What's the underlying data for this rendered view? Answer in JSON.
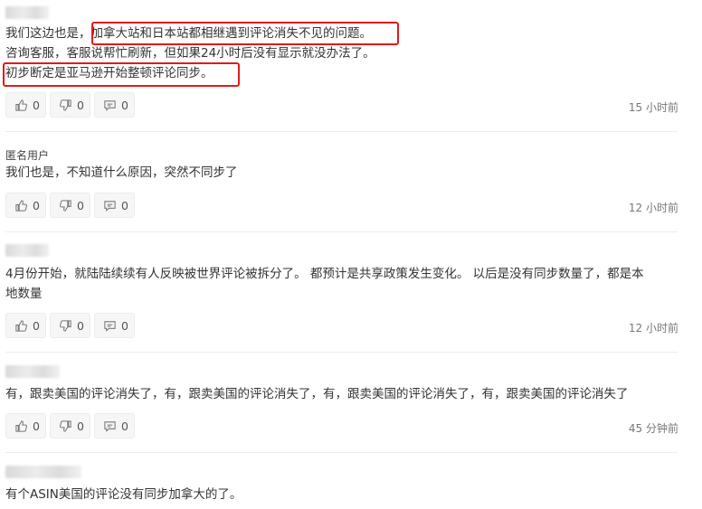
{
  "comments": [
    {
      "author": "",
      "lines": [
        "我们这边也是，加拿大站和日本站都相继遇到评论消失不见的问题。",
        "咨询客服，客服说帮忙刷新，但如果24小时后没有显示就没办法了。",
        "初步断定是亚马逊开始整顿评论同步。"
      ],
      "likes": "0",
      "dislikes": "0",
      "replies": "0",
      "time": "15 小时前"
    },
    {
      "author": "匿名用户",
      "lines": [
        "我们也是，不知道什么原因，突然不同步了"
      ],
      "likes": "0",
      "dislikes": "0",
      "replies": "0",
      "time": "12 小时前"
    },
    {
      "author": "",
      "lines": [
        "4月份开始，就陆陆续续有人反映被世界评论被拆分了。    都预计是共享政策发生变化。 以后是没有同步数量了，都是本",
        "地数量"
      ],
      "likes": "0",
      "dislikes": "0",
      "replies": "0",
      "time": "12 小时前"
    },
    {
      "author": "",
      "lines": [
        "有，跟卖美国的评论消失了，有，跟卖美国的评论消失了，有，跟卖美国的评论消失了，有，跟卖美国的评论消失了"
      ],
      "likes": "0",
      "dislikes": "0",
      "replies": "0",
      "time": "45 分钟前"
    },
    {
      "author": "",
      "lines": [
        "有个ASIN美国的评论没有同步加拿大的了。"
      ]
    }
  ],
  "colors": {
    "highlight": "#e11b1b",
    "divider": "#ececec",
    "text": "#333333"
  },
  "icons": {
    "like": "thumbs-up-icon",
    "dislike": "thumbs-down-icon",
    "reply": "comment-icon"
  }
}
